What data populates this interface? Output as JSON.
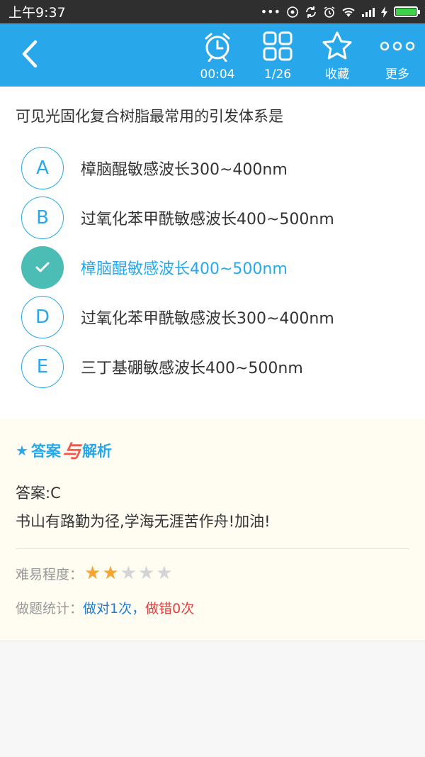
{
  "status_bar": {
    "time": "上午9:37",
    "dots": "•••"
  },
  "toolbar": {
    "timer_label": "00:04",
    "progress_label": "1/26",
    "favorite_label": "收藏",
    "more_label": "更多"
  },
  "question": {
    "text": "可见光固化复合树脂最常用的引发体系是",
    "options": [
      {
        "letter": "A",
        "text": "樟脑醌敏感波长300~400nm"
      },
      {
        "letter": "B",
        "text": "过氧化苯甲酰敏感波长400~500nm"
      },
      {
        "letter": "C",
        "text": "樟脑醌敏感波长400~500nm",
        "selected": true
      },
      {
        "letter": "D",
        "text": "过氧化苯甲酰敏感波长300~400nm"
      },
      {
        "letter": "E",
        "text": "三丁基硼敏感波长400~500nm"
      }
    ]
  },
  "analysis": {
    "title_star": "★",
    "title_a": "答案",
    "title_yu": "与",
    "title_b": "解析",
    "answer": "答案:C",
    "explanation": "书山有路勤为径,学海无涯苦作舟!加油!",
    "difficulty_label": "难易程度：",
    "difficulty_rating": 2,
    "difficulty_max": 5,
    "stats_label": "做题统计：",
    "stats_right": "做对1次",
    "stats_sep": "，",
    "stats_wrong": "做错0次"
  },
  "colors": {
    "accent": "#28a8ea",
    "selected": "#4bbdb4",
    "star_on": "#f4a532",
    "wrong": "#e24040"
  }
}
